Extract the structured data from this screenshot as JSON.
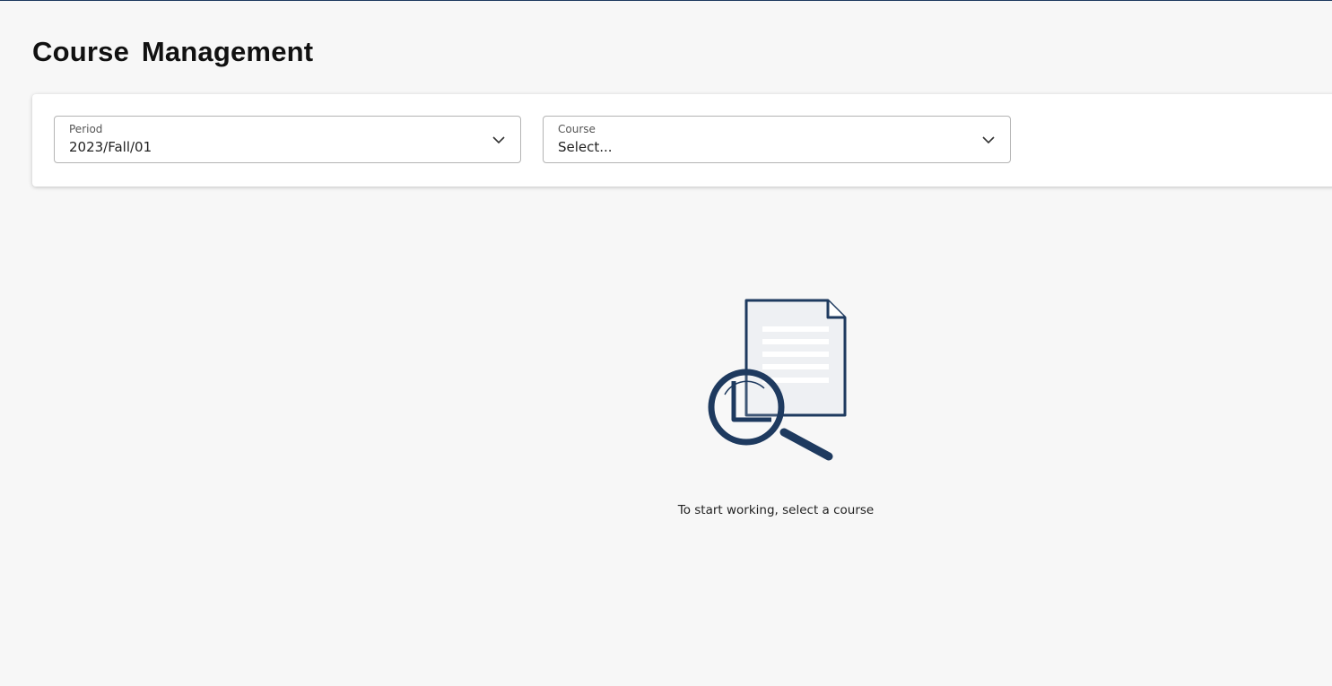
{
  "page": {
    "title": "Course Management"
  },
  "filters": {
    "period": {
      "label": "Period",
      "value": "2023/Fall/01"
    },
    "course": {
      "label": "Course",
      "value": "Select..."
    }
  },
  "empty_state": {
    "icon": "document-search-icon",
    "message": "To start working, select a course"
  },
  "colors": {
    "accent": "#1e3a5f",
    "background": "#f7f7f7",
    "card": "#ffffff",
    "border": "#b4b4b4"
  }
}
